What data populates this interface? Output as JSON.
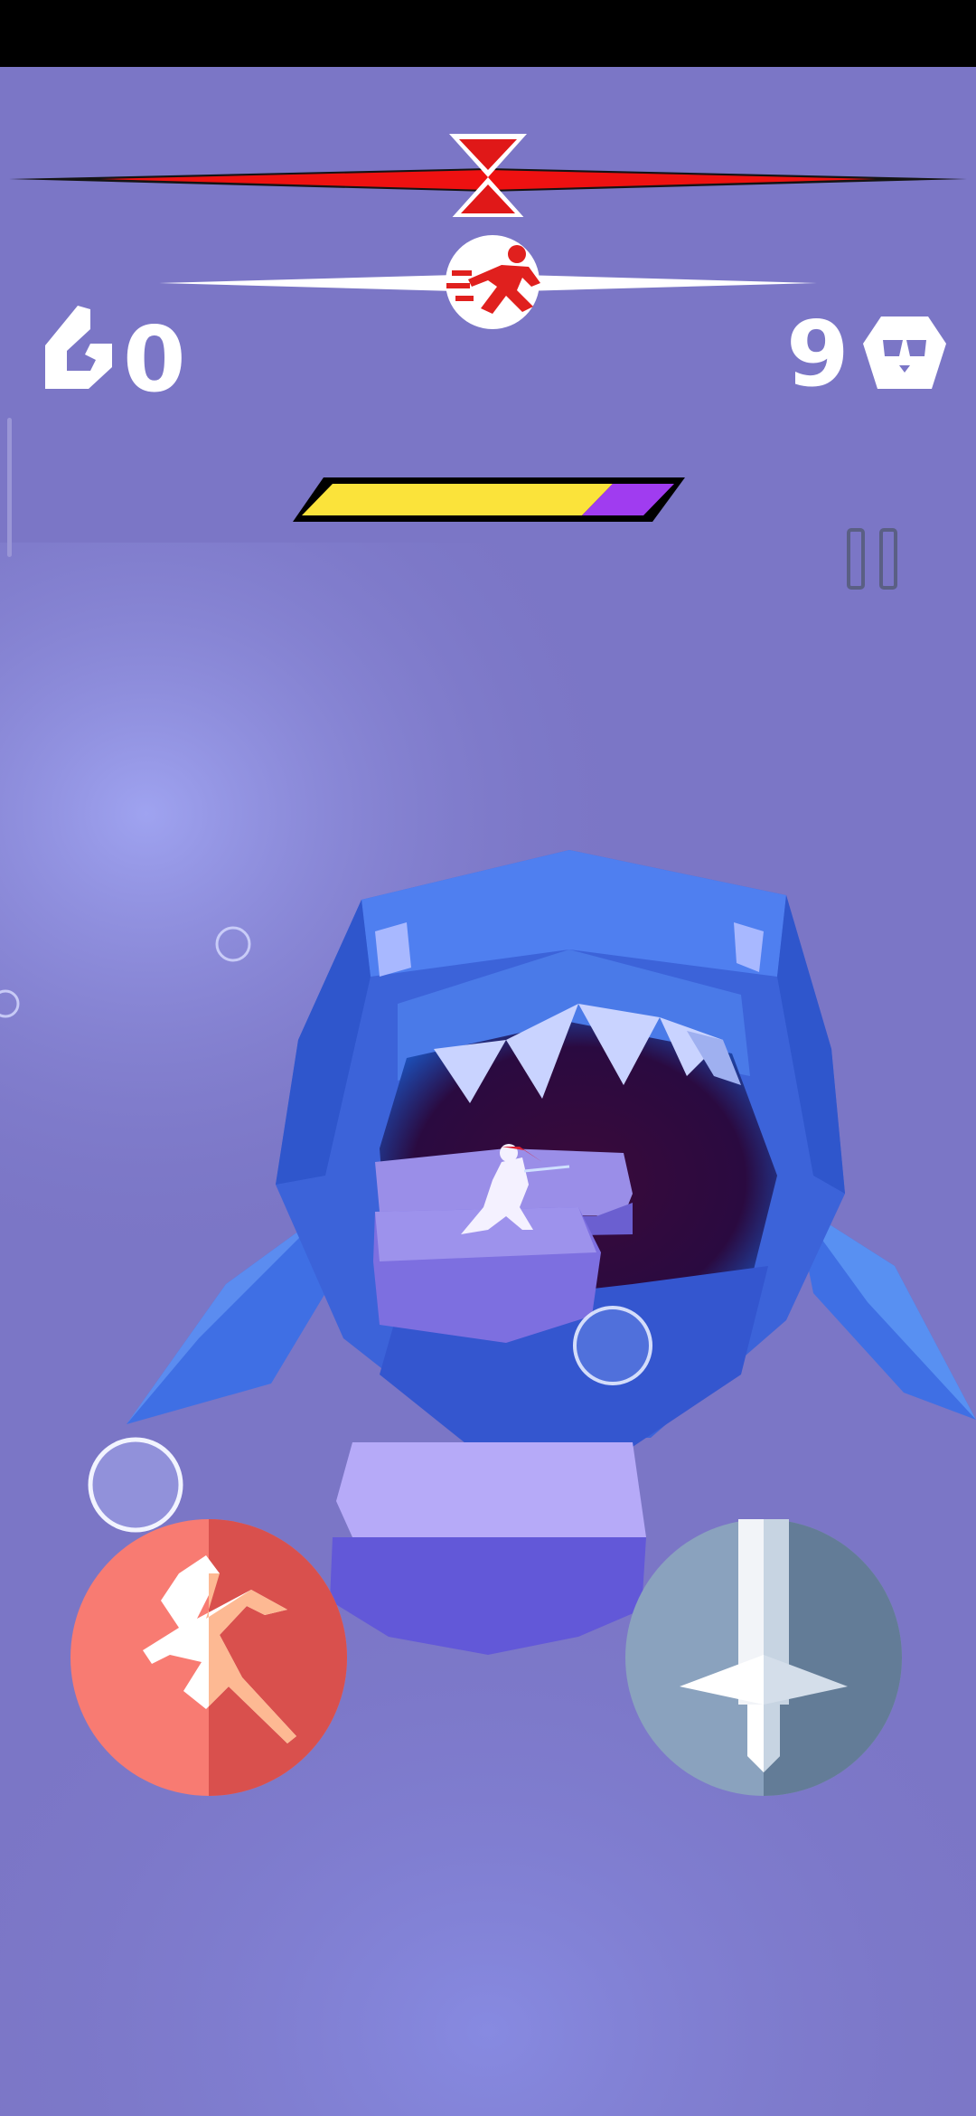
{
  "hud": {
    "gems_count": "0",
    "skulls_count": "9",
    "boss_health_fraction": 0.82,
    "colors": {
      "timer_bar": "#ee1111",
      "boss_health_fill": "#fbe33a",
      "boss_health_remaining": "#a03cf0",
      "background": "#7d78c8"
    },
    "icons": {
      "timer": "hourglass-icon",
      "speed": "running-man-icon",
      "gems": "gem-icon",
      "skulls": "skull-mask-icon",
      "pause": "pause-icon"
    }
  },
  "controls": {
    "dash_button_icon": "dash-runner-icon",
    "dash_button_color": "#f06a64",
    "attack_button_icon": "sword-icon",
    "attack_button_color": "#7f97b4"
  }
}
